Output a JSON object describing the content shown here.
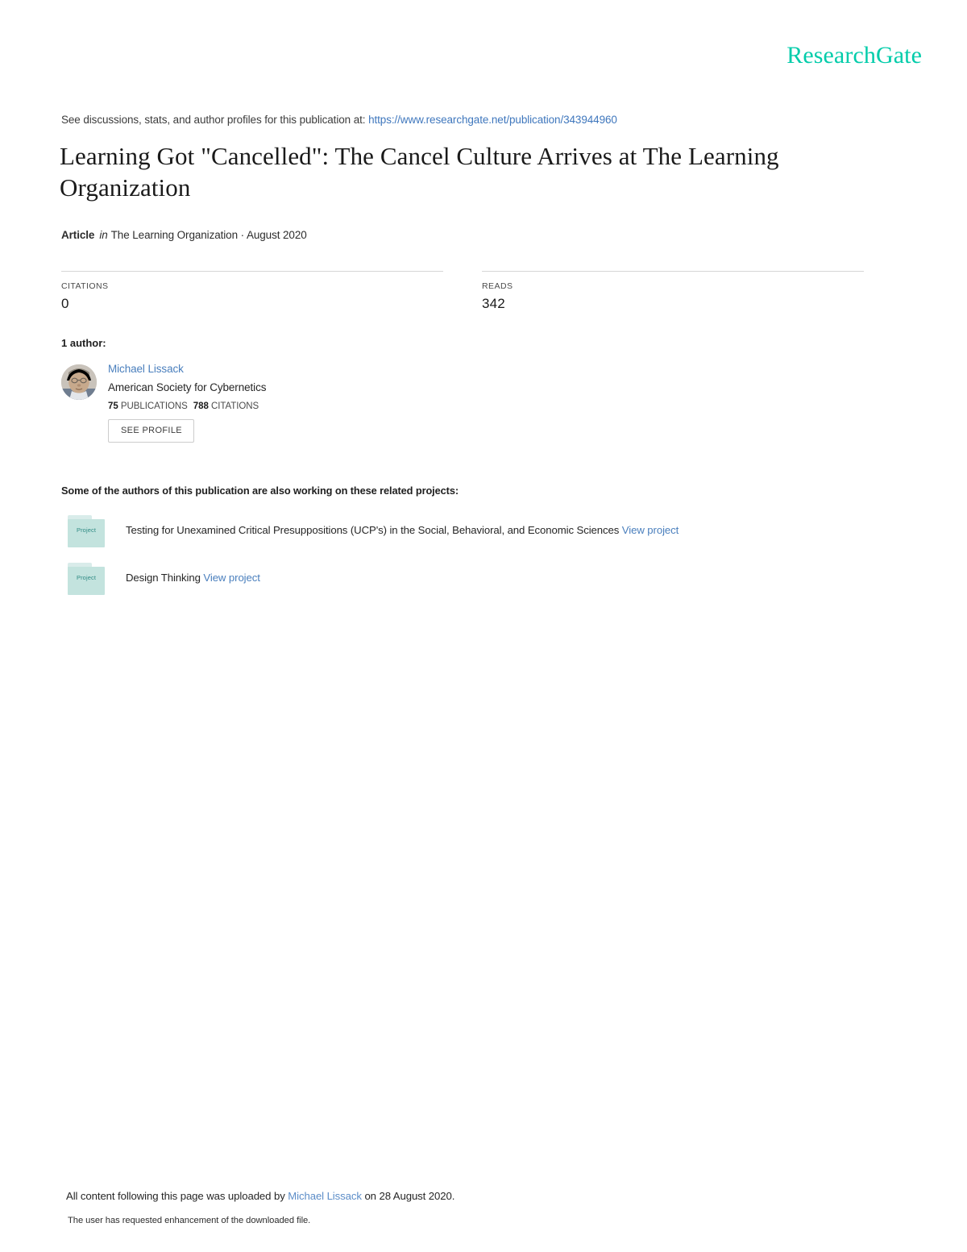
{
  "brand": {
    "name": "ResearchGate",
    "color": "#00ccaa"
  },
  "discussion": {
    "prefix": "See discussions, stats, and author profiles for this publication at:",
    "url": "https://www.researchgate.net/publication/343944960"
  },
  "publication": {
    "title": "Learning Got \"Cancelled\": The Cancel Culture Arrives at The Learning Organization",
    "kind": "Article",
    "in_word": "in",
    "venue": "The Learning Organization · August 2020"
  },
  "stats": [
    {
      "label": "CITATIONS",
      "value": "0"
    },
    {
      "label": "READS",
      "value": "342"
    }
  ],
  "authors_section": {
    "heading": "1 author:",
    "author": {
      "name": "Michael Lissack",
      "affiliation": "American Society for Cybernetics",
      "publications_count": "75",
      "publications_label": "PUBLICATIONS",
      "citations_count": "788",
      "citations_label": "CITATIONS",
      "see_profile_label": "SEE PROFILE"
    }
  },
  "projects_section": {
    "heading": "Some of the authors of this publication are also working on these related projects:",
    "icon_label": "Project",
    "items": [
      {
        "title": "Testing for Unexamined Critical Presuppositions (UCP's) in the Social, Behavioral, and Economic Sciences",
        "link_label": "View project"
      },
      {
        "title": "Design Thinking",
        "link_label": "View project"
      }
    ]
  },
  "footer": {
    "prefix": "All content following this page was uploaded by",
    "uploader": "Michael Lissack",
    "suffix": "on 28 August 2020.",
    "note": "The user has requested enhancement of the downloaded file."
  }
}
